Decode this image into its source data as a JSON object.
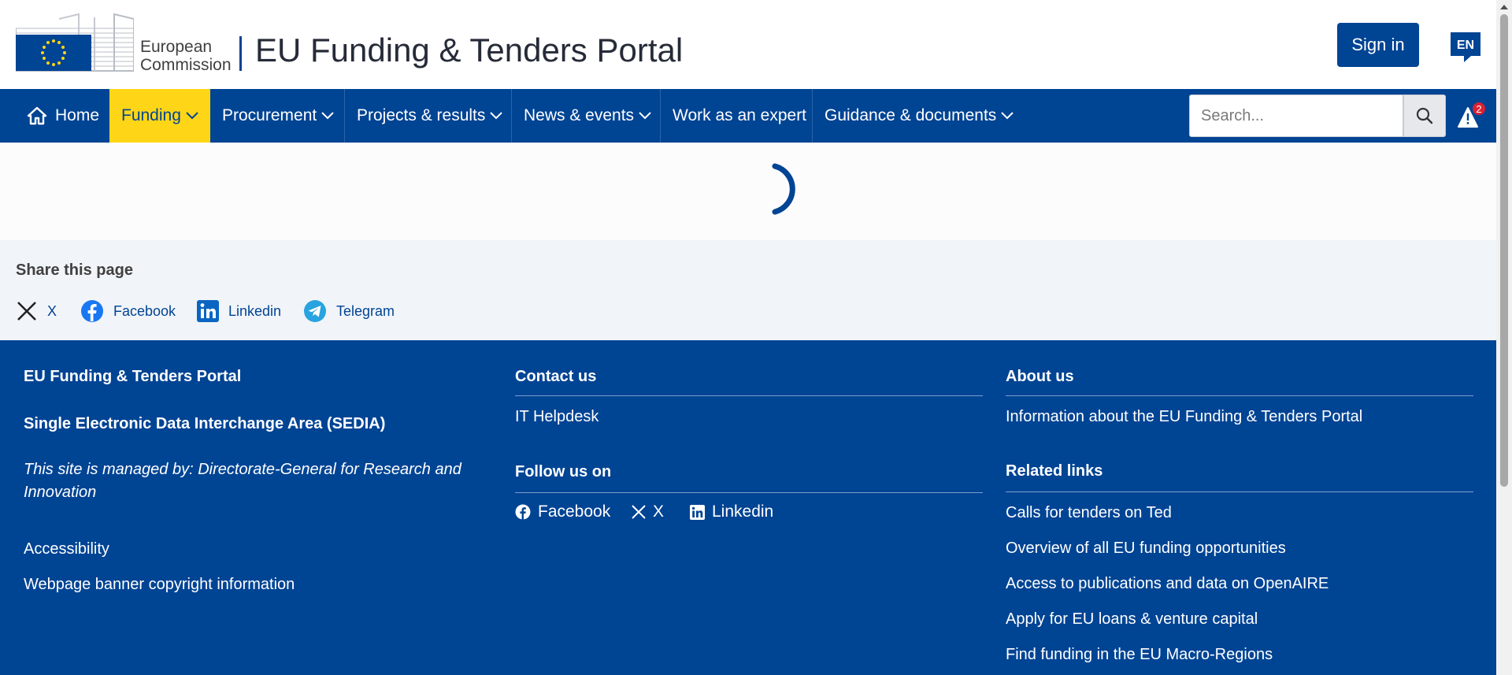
{
  "header": {
    "logo_line1": "European",
    "logo_line2": "Commission",
    "portal_title": "EU Funding & Tenders Portal",
    "sign_in": "Sign in",
    "language": "EN"
  },
  "nav": {
    "items": [
      {
        "label": "Home",
        "icon": "home-icon"
      },
      {
        "label": "Funding",
        "active": true
      },
      {
        "label": "Procurement"
      },
      {
        "label": "Projects & results"
      },
      {
        "label": "News & events"
      },
      {
        "label": "Work as an expert"
      },
      {
        "label": "Guidance & documents"
      }
    ],
    "search_placeholder": "Search...",
    "alert_count": "2"
  },
  "share": {
    "title": "Share this page",
    "links": [
      {
        "label": "X",
        "icon": "x-icon"
      },
      {
        "label": "Facebook",
        "icon": "facebook-icon"
      },
      {
        "label": "Linkedin",
        "icon": "linkedin-icon"
      },
      {
        "label": "Telegram",
        "icon": "telegram-icon"
      }
    ]
  },
  "footer": {
    "col1": {
      "title": "EU Funding & Tenders Portal",
      "subtitle": "Single Electronic Data Interchange Area (SEDIA)",
      "managed_by": "This site is managed by: Directorate-General for Research and Innovation",
      "links": [
        "Accessibility",
        "Webpage banner copyright information"
      ]
    },
    "col2": {
      "contact_title": "Contact us",
      "contact_link": "IT Helpdesk",
      "follow_title": "Follow us on",
      "follow_links": [
        {
          "label": "Facebook",
          "icon": "facebook-icon"
        },
        {
          "label": "X",
          "icon": "x-icon"
        },
        {
          "label": "Linkedin",
          "icon": "linkedin-icon"
        }
      ]
    },
    "col3": {
      "about_title": "About us",
      "about_link": "Information about the EU Funding & Tenders Portal",
      "related_title": "Related links",
      "related_links": [
        "Calls for tenders on Ted",
        "Overview of all EU funding opportunities",
        "Access to publications and data on OpenAIRE",
        "Apply for EU loans & venture capital",
        "Find funding in the EU Macro-Regions"
      ]
    }
  },
  "colors": {
    "primary": "#004494",
    "active_tab": "#ffd617",
    "alert_badge": "#da2131"
  }
}
